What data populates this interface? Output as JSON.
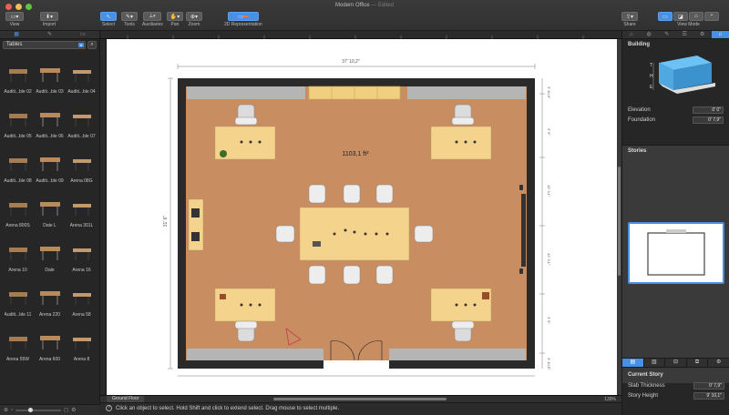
{
  "window": {
    "title": "Modern Office",
    "subtitle": "— Edited"
  },
  "toolbar": {
    "view": "View",
    "import": "Import",
    "select": "Select",
    "tools": "Tools",
    "auxiliaries": "Auxiliaries",
    "pan": "Pan",
    "zoom": "Zoom",
    "representation": "2D Representation",
    "share": "Share",
    "view_mode": "View Mode"
  },
  "library": {
    "category": "Tables",
    "items": [
      "Auditi...ble 02",
      "Auditi...ble 03",
      "Auditi...ble 04",
      "Auditi...ble 05",
      "Auditi...ble 06",
      "Auditi...ble 07",
      "Auditi...ble 08",
      "Auditi...ble 09",
      "Arena 08G",
      "Arena 800S",
      "Dale L",
      "Arena 301L",
      "Arena 10",
      "Dale",
      "Arena 16",
      "Auditi...ble 11",
      "Arena 220",
      "Arena 58",
      "Arena 55W",
      "Arena 600",
      "Arena 8"
    ]
  },
  "plan": {
    "area": "1103,1 ft²",
    "dim_top": "37' 10,2\"",
    "dim_left": "31' 6\"",
    "dim_right": [
      "3' 10,9\"",
      "3' 5\"",
      "12' 3,1\"",
      "12' 3,1\"",
      "3' 5\"",
      "3' 10,9\""
    ]
  },
  "canvas": {
    "story_tab": "Ground Floor",
    "zoom": "139%"
  },
  "inspector": {
    "section": "Building",
    "elevation_label": "Elevation",
    "elevation_value": "0' 0\"",
    "foundation_label": "Foundation",
    "foundation_value": "0' 7,9\"",
    "stories_label": "Stories",
    "current_story_label": "Current Story",
    "slab_label": "Slab Thickness",
    "slab_value": "0' 7,9\"",
    "height_label": "Story Height",
    "height_value": "9' 10,1\""
  },
  "status": {
    "message": "Click an object to select. Hold Shift and click to extend select. Drag mouse to select multiple."
  },
  "colors": {
    "accent": "#4a90e2",
    "floor": "#c98d62",
    "table": "#f4d48d"
  }
}
